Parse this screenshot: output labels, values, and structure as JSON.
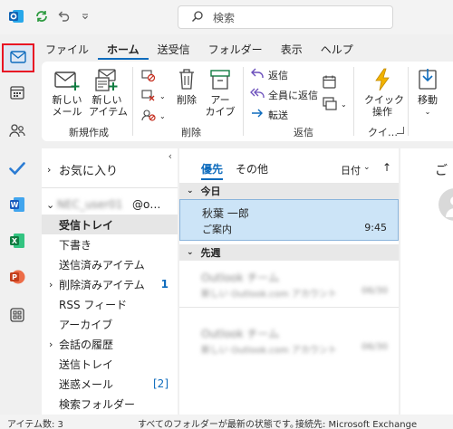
{
  "titlebar": {
    "search_placeholder": "検索"
  },
  "ribbon_tabs": [
    "ファイル",
    "ホーム",
    "送受信",
    "フォルダー",
    "表示",
    "ヘルプ"
  ],
  "ribbon": {
    "new_mail": "新しい\nメール",
    "new_items": "新しい\nアイテム",
    "group_new": "新規作成",
    "delete": "削除",
    "archive": "アー\nカイブ",
    "group_delete": "削除",
    "reply": "返信",
    "reply_all": "全員に返信",
    "forward": "転送",
    "group_reply": "返信",
    "quick_steps": "クイック\n操作",
    "group_quick": "クイ…",
    "move": "移動"
  },
  "folders": {
    "favorites": "お気に入り",
    "account_blurred": "NEC_user01",
    "account_suffix": "@o…",
    "items": [
      {
        "label": "受信トレイ",
        "count": ""
      },
      {
        "label": "下書き",
        "count": ""
      },
      {
        "label": "送信済みアイテム",
        "count": ""
      },
      {
        "label": "削除済みアイテム",
        "count": "1"
      },
      {
        "label": "RSS フィード",
        "count": ""
      },
      {
        "label": "アーカイブ",
        "count": ""
      },
      {
        "label": "会話の履歴",
        "count": ""
      },
      {
        "label": "送信トレイ",
        "count": ""
      },
      {
        "label": "迷惑メール",
        "count": "[2]"
      },
      {
        "label": "検索フォルダー",
        "count": ""
      }
    ]
  },
  "message_list": {
    "tab_focused": "優先",
    "tab_other": "その他",
    "sort": "日付",
    "group_today": "今日",
    "group_last_week": "先週",
    "selected": {
      "sender": "秋葉 一郎",
      "subject": "ご案内",
      "time": "9:45"
    },
    "blurred1": {
      "sender": "Outlook チーム",
      "subject": "新しい Outlook.com アカウント",
      "time": "06/30"
    },
    "blurred2": {
      "sender": "Outlook チーム",
      "subject": "新しい Outlook.com アカウント",
      "time": "06/30"
    }
  },
  "reading": {
    "header": "ご"
  },
  "status": {
    "items": "アイテム数: 3",
    "sync": "すべてのフォルダーが最新の状態です。",
    "connection": "接続先: Microsoft Exchange"
  },
  "colors": {
    "accent": "#0f6cbd",
    "selected_msg_bg": "#cce4f7",
    "highlight_box": "#e81123"
  }
}
